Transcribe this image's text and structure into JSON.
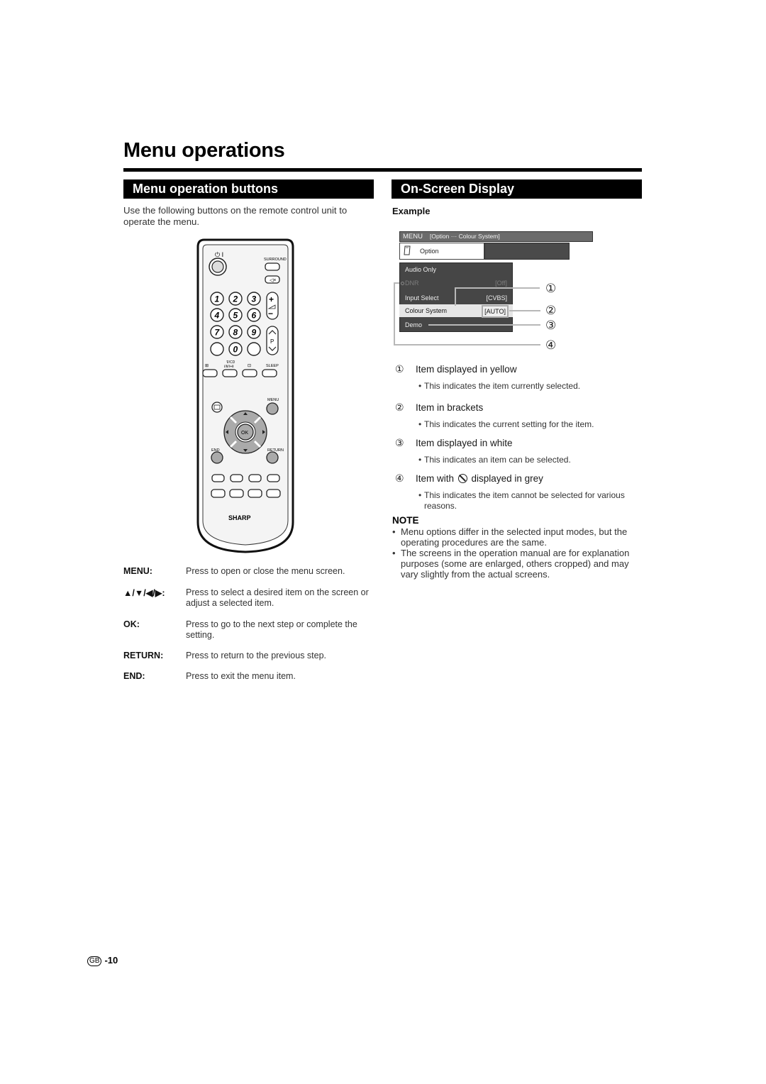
{
  "page": {
    "title": "Menu operations",
    "page_region_badge": "GB",
    "page_number": "-10"
  },
  "left_section": {
    "heading": "Menu operation buttons",
    "intro": "Use the following buttons on the remote control unit to operate the menu.",
    "remote": {
      "brand": "SHARP",
      "labels": {
        "power": "⏻ I",
        "surround": "SURROUND",
        "mute": "🔇",
        "digits": [
          "1",
          "2",
          "3",
          "4",
          "5",
          "6",
          "7",
          "8",
          "9",
          "0"
        ],
        "vol_plus": "+",
        "vol_minus": "−",
        "prog": "P",
        "audio_mode": "Ⅰ/Ⅱ/Ⅰ+Ⅱ",
        "sleep": "SLEEP",
        "menu": "MENU",
        "ok": "OK",
        "end": "END",
        "return": "RETURN"
      }
    },
    "keys": [
      {
        "label": "MENU:",
        "desc": "Press to open or close the menu screen."
      },
      {
        "label": "▲/▼/◀/▶:",
        "desc": "Press to select a desired item on the screen or adjust a selected item."
      },
      {
        "label": "OK:",
        "desc": "Press to go to the next step or complete the setting."
      },
      {
        "label": "RETURN:",
        "desc": "Press to return to the previous step."
      },
      {
        "label": "END:",
        "desc": "Press to exit the menu item."
      }
    ]
  },
  "right_section": {
    "heading": "On-Screen Display",
    "example_label": "Example",
    "osd": {
      "menubar_title": "MENU",
      "menubar_path": "[Option ··· Colour System]",
      "tab_label": "Option",
      "rows": [
        {
          "label": "Audio Only",
          "value": "",
          "state": "normal"
        },
        {
          "label": "DNR",
          "value": "[Off]",
          "state": "disabled"
        },
        {
          "label": "Input Select",
          "value": "[CVBS]",
          "state": "normal"
        },
        {
          "label": "Colour System",
          "value": "[AUTO]",
          "state": "selected"
        },
        {
          "label": "Demo",
          "value": "",
          "state": "normal"
        }
      ],
      "callouts": [
        "①",
        "②",
        "③",
        "④"
      ]
    },
    "legend": [
      {
        "num": "①",
        "title": "Item displayed in yellow",
        "desc": "This indicates the item currently selected."
      },
      {
        "num": "②",
        "title": "Item in brackets",
        "desc": "This indicates the current setting for the item."
      },
      {
        "num": "③",
        "title": "Item displayed in white",
        "desc": "This indicates an item can be selected."
      },
      {
        "num": "④",
        "title_before": "Item with",
        "title_after": "displayed in grey",
        "desc": "This indicates the item cannot be selected for various reasons."
      }
    ],
    "note": {
      "heading": "NOTE",
      "items": [
        "Menu options differ in the selected input modes, but the operating procedures are the same.",
        "The screens in the operation manual are for explanation purposes (some are enlarged, others cropped) and may vary slightly from the actual screens."
      ]
    }
  }
}
